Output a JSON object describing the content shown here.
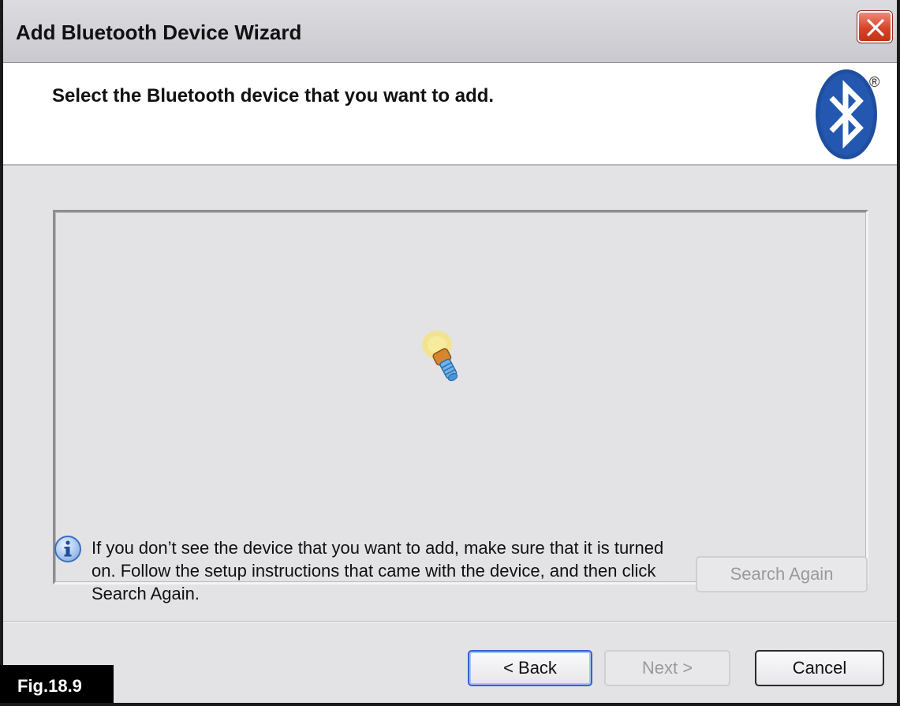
{
  "window": {
    "title": "Add Bluetooth Device Wizard"
  },
  "header": {
    "heading": "Select the Bluetooth device that you want to add.",
    "logo_icon": "bluetooth-logo",
    "registered_mark": "®"
  },
  "content": {
    "status_icon": "searching-flashlight-icon",
    "info_icon": "info-icon",
    "info_text": "If you don’t see the device that you want to add, make sure that it is turned on. Follow the setup instructions that came with the device, and then click Search Again.",
    "search_again_label": "Search Again"
  },
  "footer": {
    "back_label": "< Back",
    "next_label": "Next >",
    "cancel_label": "Cancel"
  },
  "figure_label": "Fig.18.9",
  "colors": {
    "bluetooth_blue": "#1f4e9e",
    "close_red": "#d8432a",
    "focus_blue": "#3a5fcf"
  }
}
